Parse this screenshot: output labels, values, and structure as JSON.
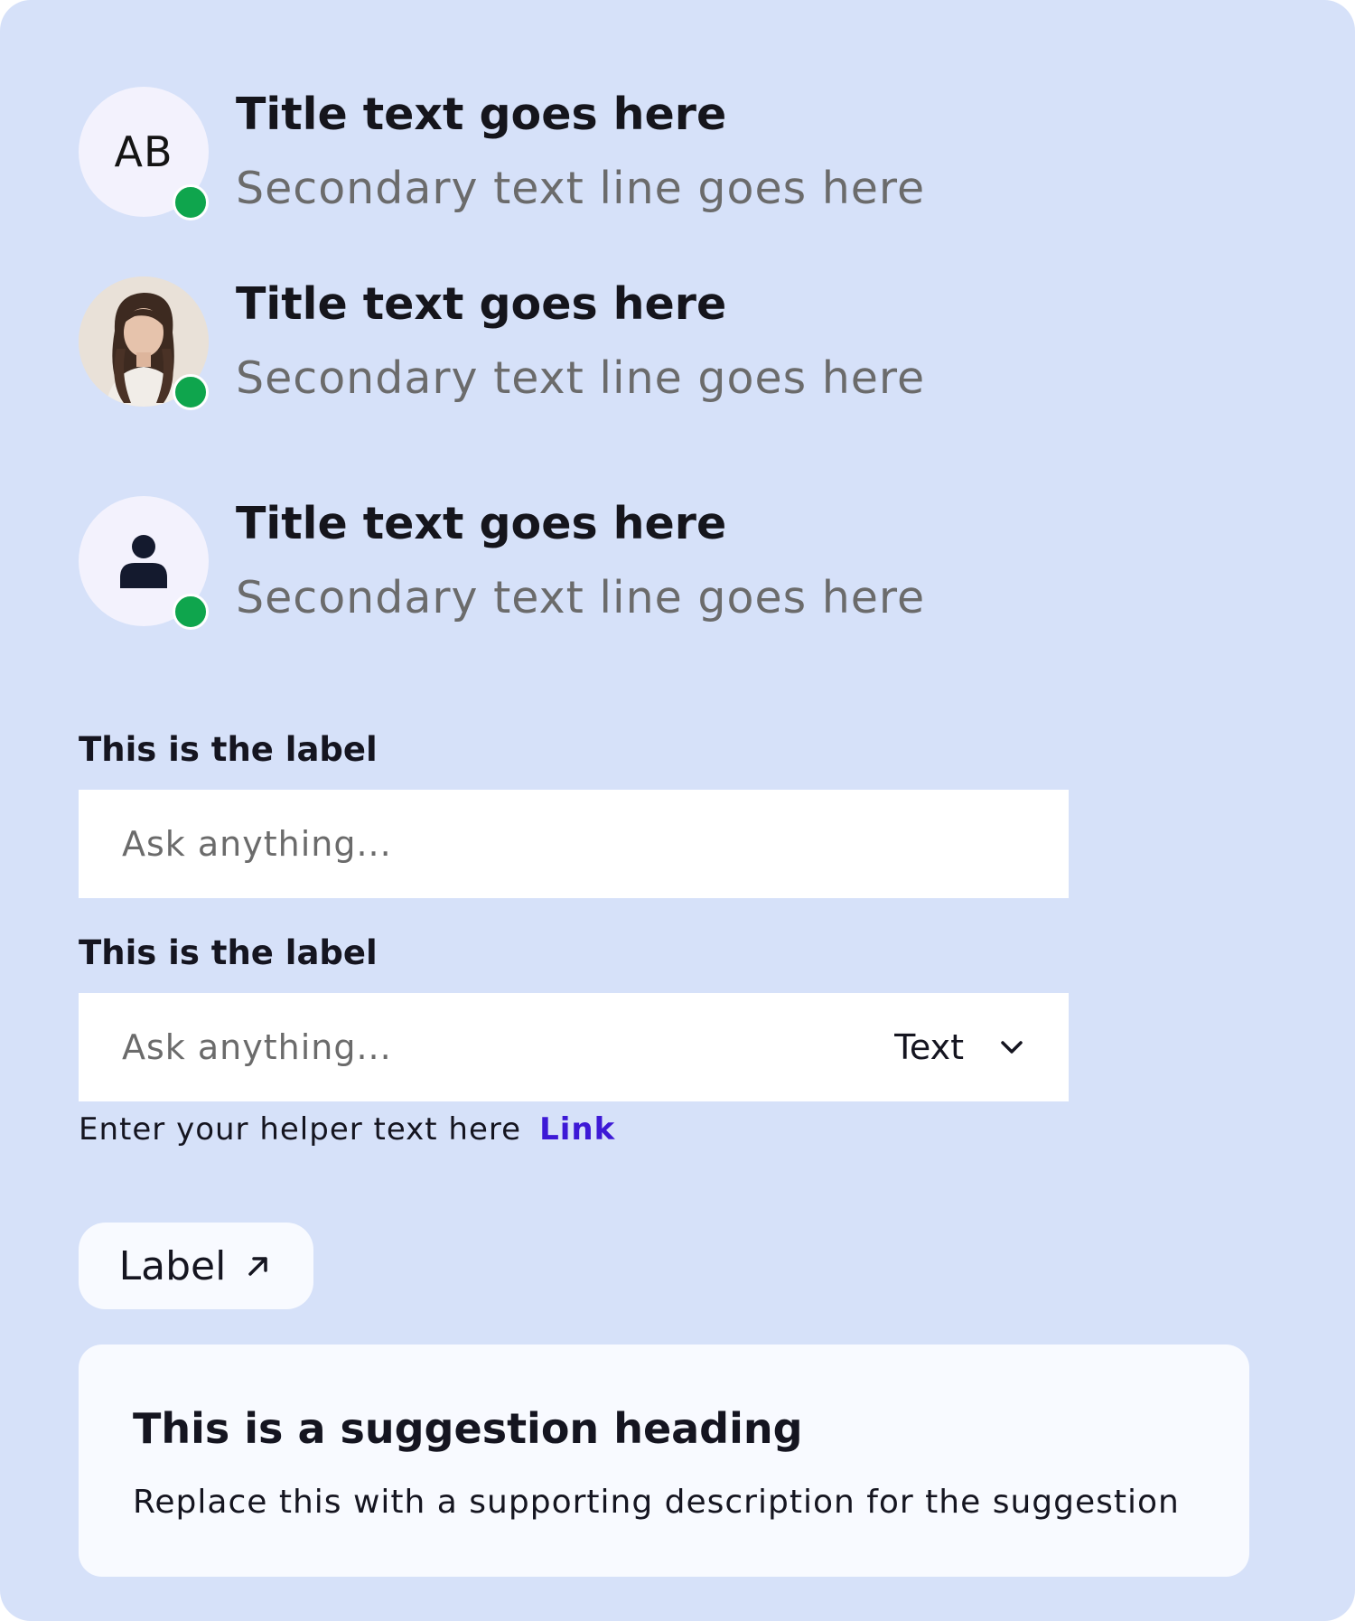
{
  "contacts": [
    {
      "avatar_type": "initials",
      "initials": "AB",
      "title": "Title text goes here",
      "secondary": "Secondary text line goes here",
      "status": "online"
    },
    {
      "avatar_type": "photo",
      "title": "Title text goes here",
      "secondary": "Secondary text line goes here",
      "status": "online"
    },
    {
      "avatar_type": "icon",
      "icon": "user-icon",
      "title": "Title text goes here",
      "secondary": "Secondary text line goes here",
      "status": "online"
    }
  ],
  "field1": {
    "label": "This is the label",
    "placeholder": "Ask anything..."
  },
  "field2": {
    "label": "This is the label",
    "placeholder": "Ask anything...",
    "select_value": "Text",
    "select_icon": "chevron-down-icon"
  },
  "helper": {
    "text": "Enter your helper text here",
    "link": "Link"
  },
  "chip": {
    "label": "Label",
    "icon": "arrow-up-right-icon"
  },
  "suggestion": {
    "heading": "This is a suggestion heading",
    "description": "Replace this with a supporting description for the suggestion"
  },
  "colors": {
    "background": "#d6e1f9",
    "status_online": "#0fa54d",
    "link": "#3d19d6",
    "avatar_bg": "#f3f2fd",
    "card_bg": "#f8faff"
  }
}
